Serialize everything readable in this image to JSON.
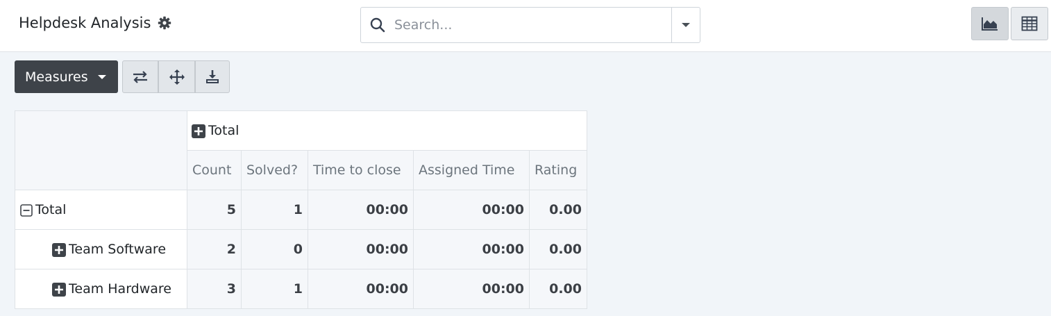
{
  "app": {
    "title": "Helpdesk Analysis"
  },
  "search": {
    "placeholder": "Search..."
  },
  "toolbar": {
    "measures_label": "Measures"
  },
  "pivot": {
    "column_header_total": "Total",
    "measures": [
      "Count",
      "Solved?",
      "Time to close",
      "Assigned Time",
      "Rating"
    ],
    "rows": [
      {
        "label": "Total",
        "values": [
          "5",
          "1",
          "00:00",
          "00:00",
          "0.00"
        ]
      },
      {
        "label": "Team Software",
        "values": [
          "2",
          "0",
          "00:00",
          "00:00",
          "0.00"
        ]
      },
      {
        "label": "Team Hardware",
        "values": [
          "3",
          "1",
          "00:00",
          "00:00",
          "0.00"
        ]
      }
    ]
  },
  "icons": [
    "gear-icon",
    "search-icon",
    "chevron-down-icon",
    "area-chart-icon",
    "table-icon",
    "flip-axis-icon",
    "expand-all-icon",
    "download-icon",
    "plus-square-icon",
    "minus-square-icon"
  ],
  "colors": {
    "measures_bg": "#3e4349",
    "page_bg": "#f1f5f9"
  }
}
